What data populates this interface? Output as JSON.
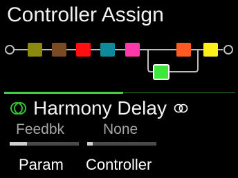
{
  "screen": {
    "title": "Controller Assign"
  },
  "signal_chain": {
    "colors": {
      "line": "#bdbdbd",
      "slot_1": "#8a8a10",
      "slot_2": "#7a4a22",
      "slot_3": "#ff0f0f",
      "slot_4": "#0f8a9a",
      "slot_5": "#ff3aa8",
      "slot_6": "#ff5a22",
      "slot_7": "#ffef1a",
      "slot_parallel": "#3ce83c"
    }
  },
  "selected_block": {
    "name": "Harmony Delay",
    "category_icon": "delay-rings-icon",
    "model_icon": "stereo-rings-icon",
    "accent_color": "#35c235"
  },
  "params": [
    {
      "label": "Feedbk",
      "level": 0.25
    },
    {
      "label": "None",
      "level": 0.08
    }
  ],
  "softkeys": {
    "param": "Param",
    "controller": "Controller"
  }
}
